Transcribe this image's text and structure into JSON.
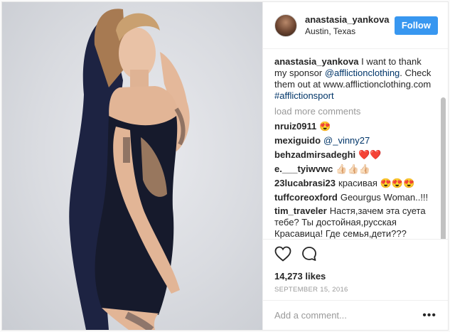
{
  "post": {
    "username": "anastasia_yankova",
    "location": "Austin, Texas",
    "follow_label": "Follow",
    "caption": {
      "username": "anastasia_yankova",
      "text_1": " I want to thank my sponsor ",
      "mention": "@afflictionclothing",
      "text_2": ". Check them out at www.afflictionclothing.com ",
      "hashtag": "#afflictionsport"
    },
    "load_more": "load more comments",
    "comments": [
      {
        "username": "nruiz0911",
        "text": "😍"
      },
      {
        "username": "mexiguido",
        "text": "",
        "mention": "@_vinny27"
      },
      {
        "username": "behzadmirsadeghi",
        "text": "❤️❤️"
      },
      {
        "username": "e.___tyiwvwc",
        "text": "👍🏻👍🏻👍🏻"
      },
      {
        "username": "23lucabrasi23",
        "text": "красивая 😍😍😍"
      },
      {
        "username": "tuffcoreoxford",
        "text": "Geourgus Woman..!!!"
      },
      {
        "username": "tim_traveler",
        "text": "Настя,зачем эта суета тебе? Ты достойная,русская Красавица! Где семья,дети??? Уверен,что в роли супруги и мамы у Тебя будет успех👌 а бить лица и самой получать - это чъанда."
      }
    ],
    "likes": "14,273 likes",
    "date": "SEPTEMBER 15, 2016",
    "add_comment_placeholder": "Add a comment...",
    "more_icon": "•••"
  },
  "colors": {
    "follow_button": "#3897f0",
    "link": "#003569",
    "muted": "#999999",
    "text": "#262626"
  },
  "icons": [
    "heart-icon",
    "comment-icon",
    "more-options-icon"
  ]
}
